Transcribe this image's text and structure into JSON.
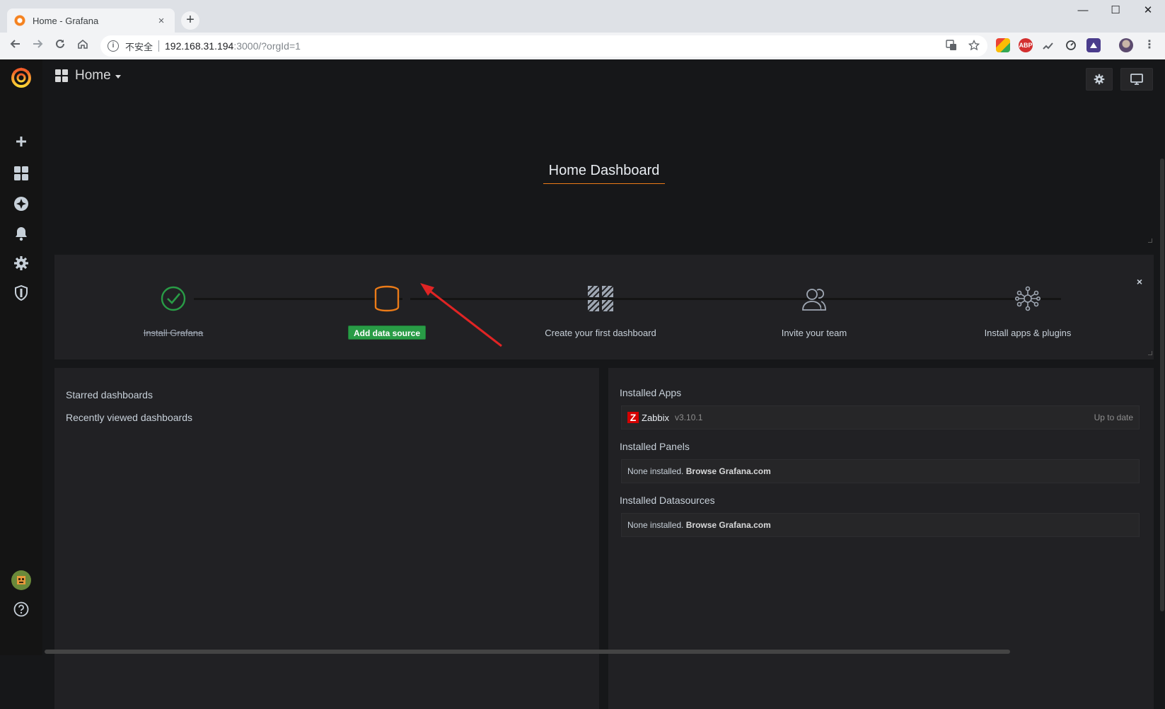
{
  "browser": {
    "tab_title": "Home - Grafana",
    "tab_close": "×",
    "new_tab": "+",
    "security_label": "不安全",
    "url_host": "192.168.31.194",
    "url_rest": ":3000/?orgId=1",
    "window_controls": {
      "minimize": "—",
      "maximize": "☐",
      "close": "✕"
    }
  },
  "extensions": [
    {
      "name": "google-ext-icon",
      "color": "#34a853"
    },
    {
      "name": "adblock-icon",
      "label": "ABP",
      "color": "#d32f2f"
    },
    {
      "name": "extension-icon",
      "color": "#5f6368"
    },
    {
      "name": "gauge-icon",
      "color": "#5f6368"
    },
    {
      "name": "extension-icon",
      "color": "#4a3c8c"
    }
  ],
  "navbar": {
    "title": "Home"
  },
  "dashboard": {
    "headline": "Home Dashboard"
  },
  "steps": [
    {
      "label": "Install Grafana",
      "state": "done"
    },
    {
      "label": "Add data source",
      "state": "active"
    },
    {
      "label": "Create your first dashboard",
      "state": "todo"
    },
    {
      "label": "Invite your team",
      "state": "todo"
    },
    {
      "label": "Install apps & plugins",
      "state": "todo"
    }
  ],
  "steps_dismiss": "×",
  "left_panel": {
    "starred": "Starred dashboards",
    "recent": "Recently viewed dashboards"
  },
  "right_panel": {
    "apps_heading": "Installed Apps",
    "app": {
      "logo": "Z",
      "name": "Zabbix",
      "version": "v3.10.1",
      "status": "Up to date"
    },
    "panels_heading": "Installed Panels",
    "panels_none": "None installed.",
    "panels_link": "Browse Grafana.com",
    "datasources_heading": "Installed Datasources",
    "datasources_none": "None installed.",
    "datasources_link": "Browse Grafana.com"
  },
  "colors": {
    "accent": "#eb7b18",
    "success": "#299c46",
    "annotation_arrow": "#e02424"
  }
}
